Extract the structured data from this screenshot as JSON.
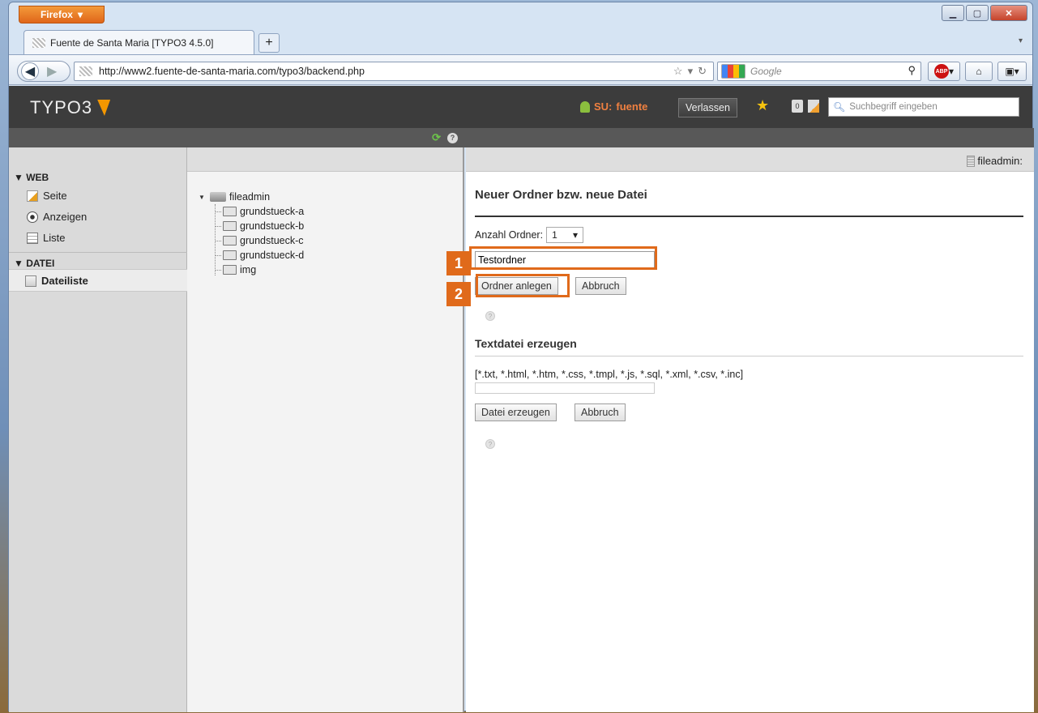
{
  "browser": {
    "menu_button": "Firefox",
    "tab_title": "Fuente de Santa Maria [TYPO3 4.5.0]",
    "new_tab": "+",
    "url": "http://www2.fuente-de-santa-maria.com/typo3/backend.php",
    "search_engine": "Google",
    "adblock": "ABP"
  },
  "typo3": {
    "logo": "TYPO3",
    "user_prefix": "SU:",
    "user_name": "fuente",
    "logout": "Verlassen",
    "cache_count": "0",
    "search_placeholder": "Suchbegriff eingeben",
    "accent_color": "#f49700"
  },
  "modules": {
    "groups": [
      {
        "title": "▼ WEB",
        "items": [
          {
            "label": "Seite",
            "icon": "page-edit-icon"
          },
          {
            "label": "Anzeigen",
            "icon": "eye-icon"
          },
          {
            "label": "Liste",
            "icon": "list-icon"
          }
        ]
      },
      {
        "title": "▼ DATEI",
        "items": [
          {
            "label": "Dateiliste",
            "icon": "filelist-icon",
            "active": true
          }
        ]
      }
    ]
  },
  "tree": {
    "root": "fileadmin",
    "children": [
      "grundstueck-a",
      "grundstueck-b",
      "grundstueck-c",
      "grundstueck-d",
      "img"
    ]
  },
  "content": {
    "path_label": "fileadmin:",
    "heading": "Neuer Ordner bzw. neue Datei",
    "anzahl_label": "Anzahl Ordner:",
    "anzahl_value": "1",
    "folder_name_value": "Testordner",
    "create_folder_button": "Ordner anlegen",
    "cancel_button": "Abbruch",
    "textfile_heading": "Textdatei erzeugen",
    "allowed_types": "[*.txt, *.html, *.htm, *.css, *.tmpl, *.js, *.sql, *.xml, *.csv, *.inc]",
    "textfile_value": "",
    "create_file_button": "Datei erzeugen",
    "cancel_button_2": "Abbruch"
  },
  "annotations": {
    "marker_1": "1",
    "marker_2": "2",
    "color": "#e06a1b"
  }
}
